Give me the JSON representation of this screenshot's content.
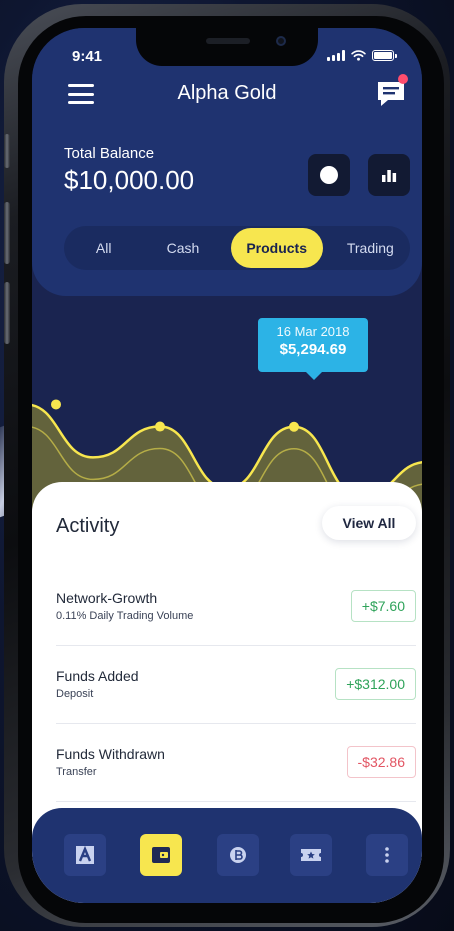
{
  "status_bar": {
    "time": "9:41"
  },
  "header": {
    "title": "Alpha Gold"
  },
  "balance": {
    "label": "Total Balance",
    "value": "$10,000.00"
  },
  "tabs": [
    {
      "label": "All",
      "active": false
    },
    {
      "label": "Cash",
      "active": false
    },
    {
      "label": "Products",
      "active": true
    },
    {
      "label": "Trading",
      "active": false
    }
  ],
  "chart_data": {
    "type": "area",
    "series": [
      {
        "points": [
          [
            0,
            5800
          ],
          [
            1,
            4600
          ],
          [
            2,
            5300
          ],
          [
            3,
            3900
          ],
          [
            4,
            5295
          ],
          [
            5,
            3700
          ],
          [
            6,
            4500
          ]
        ]
      }
    ],
    "tooltip": {
      "date": "16 Mar 2018",
      "value": "$5,294.69"
    }
  },
  "activity": {
    "title": "Activity",
    "view_all_label": "View All",
    "items": [
      {
        "title": "Network-Growth",
        "subtitle": "0.11% Daily Trading Volume",
        "amount": "+$7.60",
        "kind": "pos"
      },
      {
        "title": "Funds Added",
        "subtitle": "Deposit",
        "amount": "+$312.00",
        "kind": "pos"
      },
      {
        "title": "Funds Withdrawn",
        "subtitle": "Transfer",
        "amount": "-$32.86",
        "kind": "neg"
      }
    ]
  },
  "nav": {
    "items": [
      {
        "icon": "a-logo-icon",
        "active": false
      },
      {
        "icon": "wallet-icon",
        "active": true
      },
      {
        "icon": "coin-icon",
        "active": false
      },
      {
        "icon": "ticket-icon",
        "active": false
      },
      {
        "icon": "more-vertical-icon",
        "active": false
      }
    ]
  },
  "colors": {
    "accent": "#f7e64f",
    "header_bg": "#1f3370",
    "tooltip_bg": "#2cb3e6",
    "positive": "#2fa35a",
    "negative": "#e25563"
  }
}
